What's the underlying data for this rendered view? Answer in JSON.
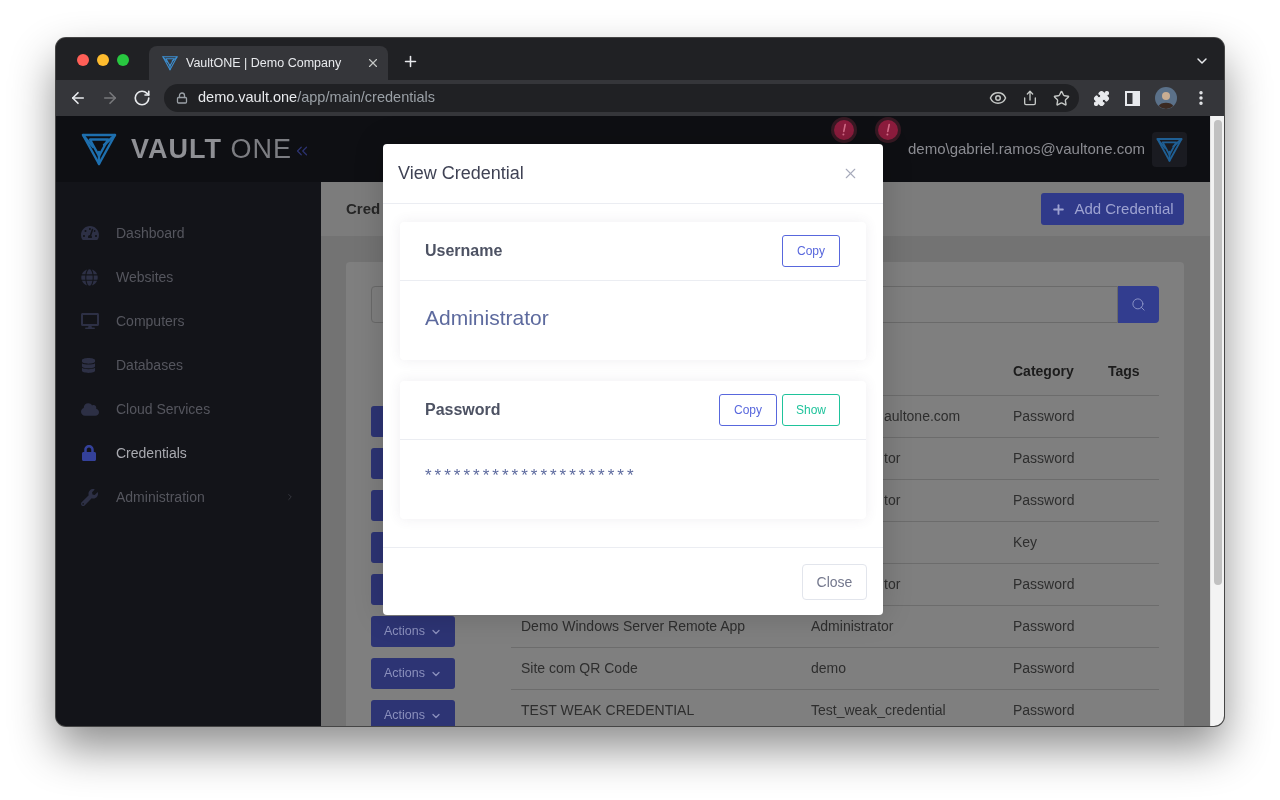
{
  "browser": {
    "tabs": [
      {
        "title": "VaultONE | Demo Company",
        "selected": true
      }
    ],
    "nav_buttons": [
      {
        "kind": "back",
        "disabled": false
      },
      {
        "kind": "forward",
        "disabled": true
      },
      {
        "kind": "reload",
        "disabled": false
      }
    ],
    "url": {
      "host": "demo.vault.one",
      "path": "/app/main/credentials"
    }
  },
  "app": {
    "logo": "**VAULT** ONE",
    "user": "demo\\gabriel.ramos@vaultone.com"
  },
  "sidebar": {
    "items": [
      {
        "label": "Dashboard",
        "kind": "dashboard",
        "selected": false,
        "has_submenu": false
      },
      {
        "label": "Websites",
        "kind": "websites",
        "selected": false,
        "has_submenu": false
      },
      {
        "label": "Computers",
        "kind": "computers",
        "selected": false,
        "has_submenu": false
      },
      {
        "label": "Databases",
        "kind": "databases",
        "selected": false,
        "has_submenu": false
      },
      {
        "label": "Cloud Services",
        "kind": "cloud",
        "selected": false,
        "has_submenu": false
      },
      {
        "label": "Credentials",
        "kind": "credentials",
        "selected": true,
        "has_submenu": false
      },
      {
        "label": "Administration",
        "kind": "administration",
        "selected": false,
        "has_submenu": true
      }
    ]
  },
  "page": {
    "title": "Cred",
    "add_button": "Add Credential"
  },
  "table": {
    "columns": [
      {
        "label": "Category"
      },
      {
        "label": "Tags"
      }
    ],
    "rows": [
      {
        "kind": "covered",
        "username": "aultone.com",
        "category": "Password"
      },
      {
        "kind": "covered",
        "username": "tor",
        "category": "Password"
      },
      {
        "kind": "covered",
        "username": "tor",
        "category": "Password"
      },
      {
        "kind": "covered",
        "category": "Key"
      },
      {
        "kind": "covered",
        "username": "tor",
        "category": "Password"
      },
      {
        "kind": "full",
        "action": "Actions",
        "name": "Demo Windows Server Remote App",
        "username": "Administrator",
        "category": "Password"
      },
      {
        "kind": "full",
        "action": "Actions",
        "name": "Site com QR Code",
        "username": "demo",
        "category": "Password"
      },
      {
        "kind": "full",
        "action": "Actions",
        "name": "TEST WEAK CREDENTIAL",
        "username": "Test_weak_credential",
        "category": "Password"
      }
    ]
  },
  "dialog": {
    "title": "View Credential",
    "fields": [
      {
        "label": "Username",
        "value": "Administrator",
        "masked": false,
        "buttons": [
          {
            "label": "Copy",
            "kind": "copy"
          }
        ]
      },
      {
        "label": "Password",
        "value": "**********************",
        "masked": true,
        "buttons": [
          {
            "label": "Copy",
            "kind": "copy"
          },
          {
            "label": "Show",
            "kind": "show"
          }
        ]
      }
    ],
    "close_button": "Close"
  }
}
